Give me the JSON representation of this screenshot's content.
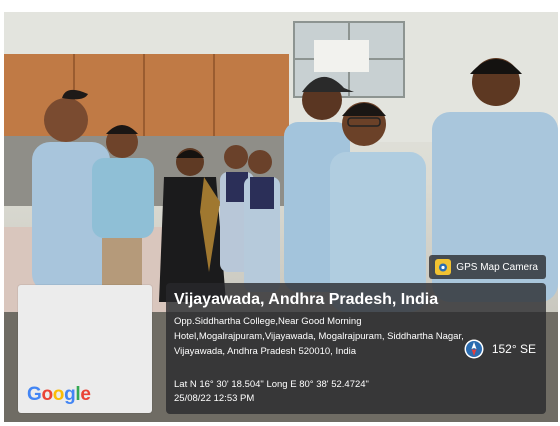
{
  "badge": {
    "label": "GPS Map Camera",
    "icon": "gps-map-camera-icon"
  },
  "location": {
    "title": "Vijayawada, Andhra Pradesh, India",
    "address": "Opp.Siddhartha College,Near Good Morning Hotel,Mogalrajpuram,Vijayawada, Mogalrajpuram, Siddhartha Nagar, Vijayawada, Andhra Pradesh 520010, India",
    "coordinates": "Lat N 16° 30' 18.504\" Long E 80° 38' 52.4724\"",
    "timestamp": "25/08/22 12:53 PM",
    "heading": "152° SE"
  },
  "map": {
    "brand_letters": [
      {
        "char": "G",
        "color": "#4285F4"
      },
      {
        "char": "o",
        "color": "#EA4335"
      },
      {
        "char": "o",
        "color": "#FBBC05"
      },
      {
        "char": "g",
        "color": "#4285F4"
      },
      {
        "char": "l",
        "color": "#34A853"
      },
      {
        "char": "e",
        "color": "#EA4335"
      }
    ]
  },
  "colors": {
    "overlay": "#28282c",
    "shirt_blue": "#a9c6dc",
    "cabinet": "#c07a45"
  }
}
